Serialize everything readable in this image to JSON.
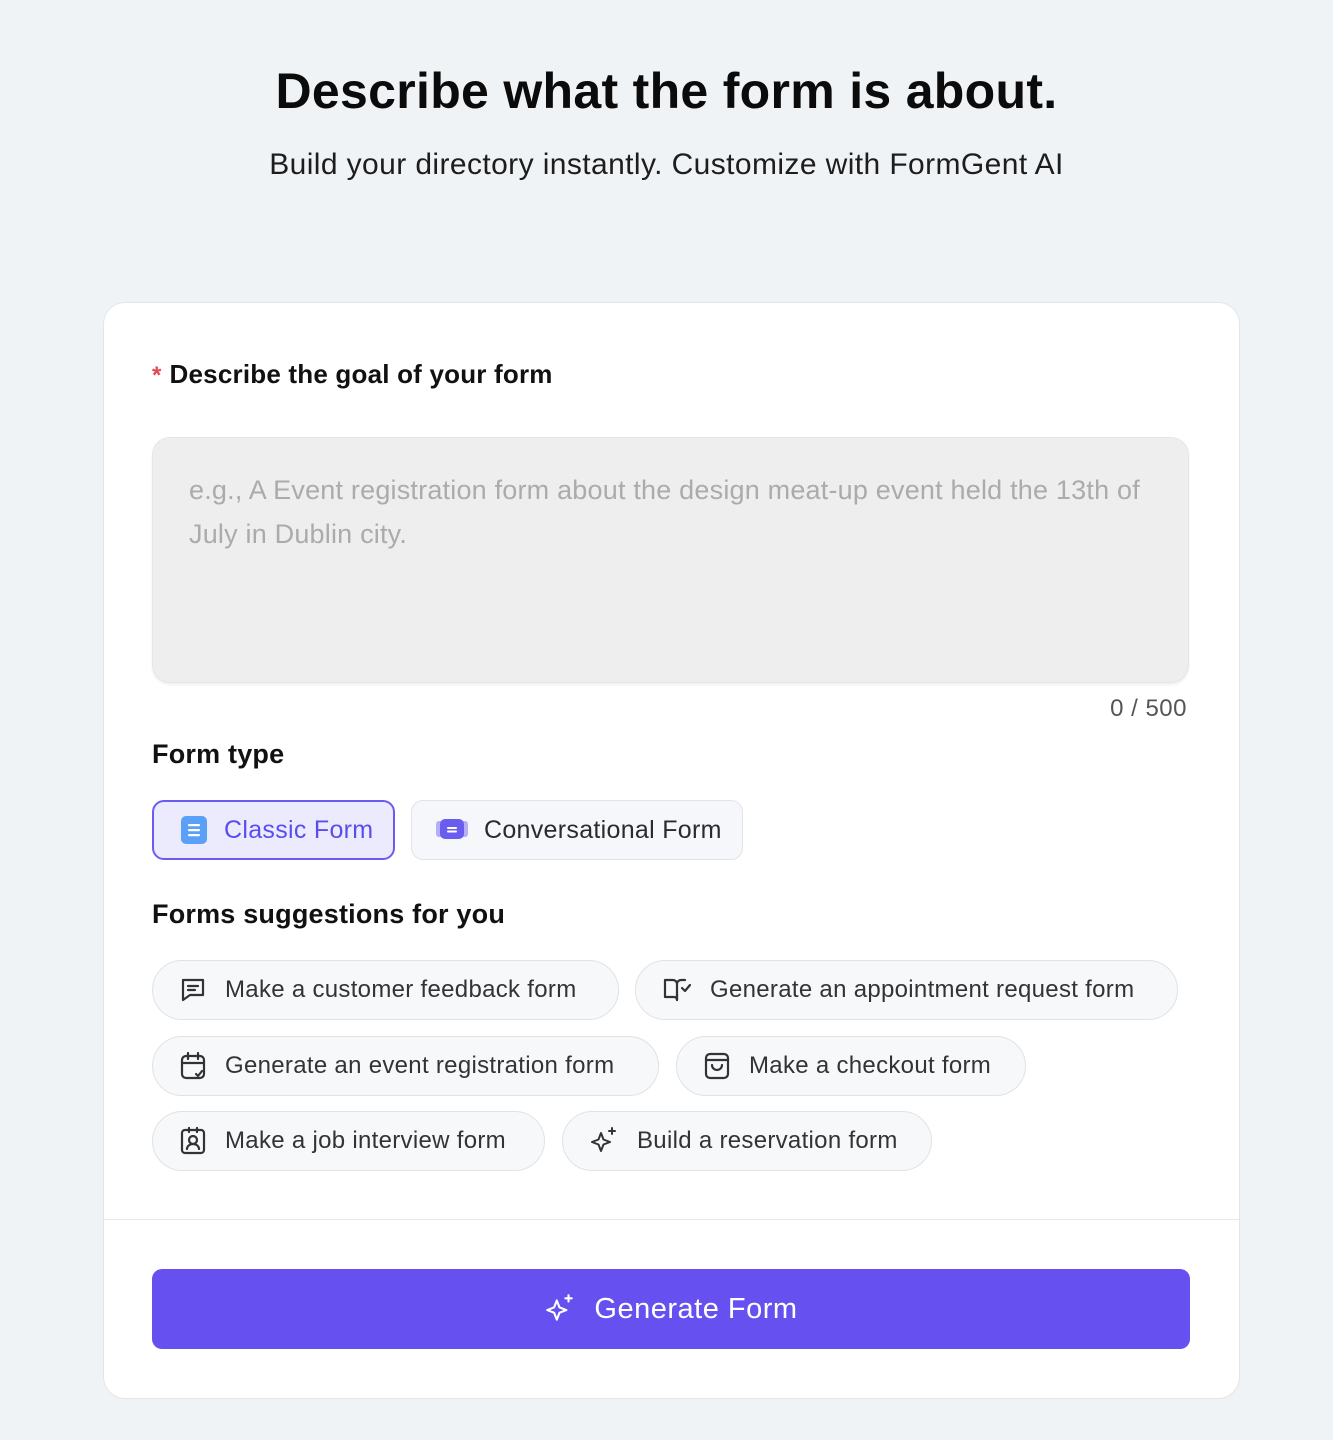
{
  "header": {
    "title": "Describe what the form is about.",
    "subtitle": "Build your directory instantly. Customize with FormGent AI"
  },
  "goal": {
    "required_mark": "*",
    "label": "Describe the goal of your form",
    "placeholder": "e.g., A Event registration form about the design meat-up event held the 13th of July in Dublin city.",
    "value": "",
    "char_count": "0 / 500"
  },
  "form_type": {
    "title": "Form type",
    "options": [
      {
        "label": "Classic Form",
        "icon": "document-icon",
        "selected": true
      },
      {
        "label": "Conversational Form",
        "icon": "chat-bubble-icon",
        "selected": false
      }
    ]
  },
  "suggestions": {
    "title": "Forms suggestions for you",
    "items": [
      {
        "label": "Make a customer feedback form",
        "icon": "message-icon"
      },
      {
        "label": "Generate an appointment request form",
        "icon": "book-check-icon"
      },
      {
        "label": "Generate an event registration form",
        "icon": "calendar-icon"
      },
      {
        "label": "Make a checkout form",
        "icon": "shopping-bag-icon"
      },
      {
        "label": "Make a job interview form",
        "icon": "id-badge-icon"
      },
      {
        "label": "Build a reservation form",
        "icon": "sparkle-icon"
      }
    ]
  },
  "generate": {
    "label": "Generate Form",
    "icon": "sparkle-icon"
  },
  "colors": {
    "accent": "#6650ef",
    "selected_bg": "#eceafd",
    "required": "#e0484e",
    "page_bg": "#f0f3f6"
  }
}
